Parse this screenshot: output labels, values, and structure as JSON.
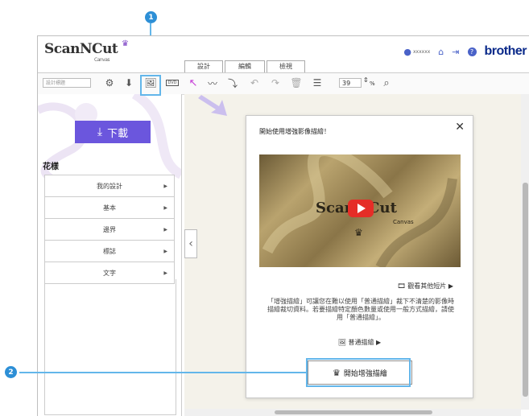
{
  "header": {
    "logo_text": "ScanNCut",
    "logo_sub": "Canvas",
    "username": "xxxxxx",
    "brand": "brother"
  },
  "tabs": [
    {
      "label": "設計"
    },
    {
      "label": "編輯"
    },
    {
      "label": "檢視"
    }
  ],
  "toolbar": {
    "title_placeholder": "設計標題",
    "zoom_value": "39",
    "zoom_unit": "%"
  },
  "sidebar": {
    "download_label": "下載",
    "section_title": "花樣",
    "menu_items": [
      {
        "label": "我的設計"
      },
      {
        "label": "基本"
      },
      {
        "label": "邊界"
      },
      {
        "label": "標誌"
      },
      {
        "label": "文字"
      }
    ]
  },
  "dialog": {
    "title": "開始使用增強影像描繪！",
    "close_symbol": "✕",
    "video_logo": "ScanNCut",
    "video_sub": "Canvas",
    "more_videos": "觀看其他短片 ▶",
    "description": "「增強描繪」可讓您在難以使用「普通描繪」裁下不清楚的影像時描繪裁切資料。若要描繪特定顏色數量或使用一般方式描繪，請使用「普通描繪」。",
    "normal_trace": "普通描繪 ▶",
    "start_button": "開始增強描繪"
  },
  "callouts": [
    {
      "label": "1"
    },
    {
      "label": "2"
    }
  ],
  "colors": {
    "accent_purple": "#6b56dd",
    "callout_blue": "#63b6ea",
    "badge_blue": "#2d8fd6",
    "brand_blue": "#0a2a8a"
  }
}
